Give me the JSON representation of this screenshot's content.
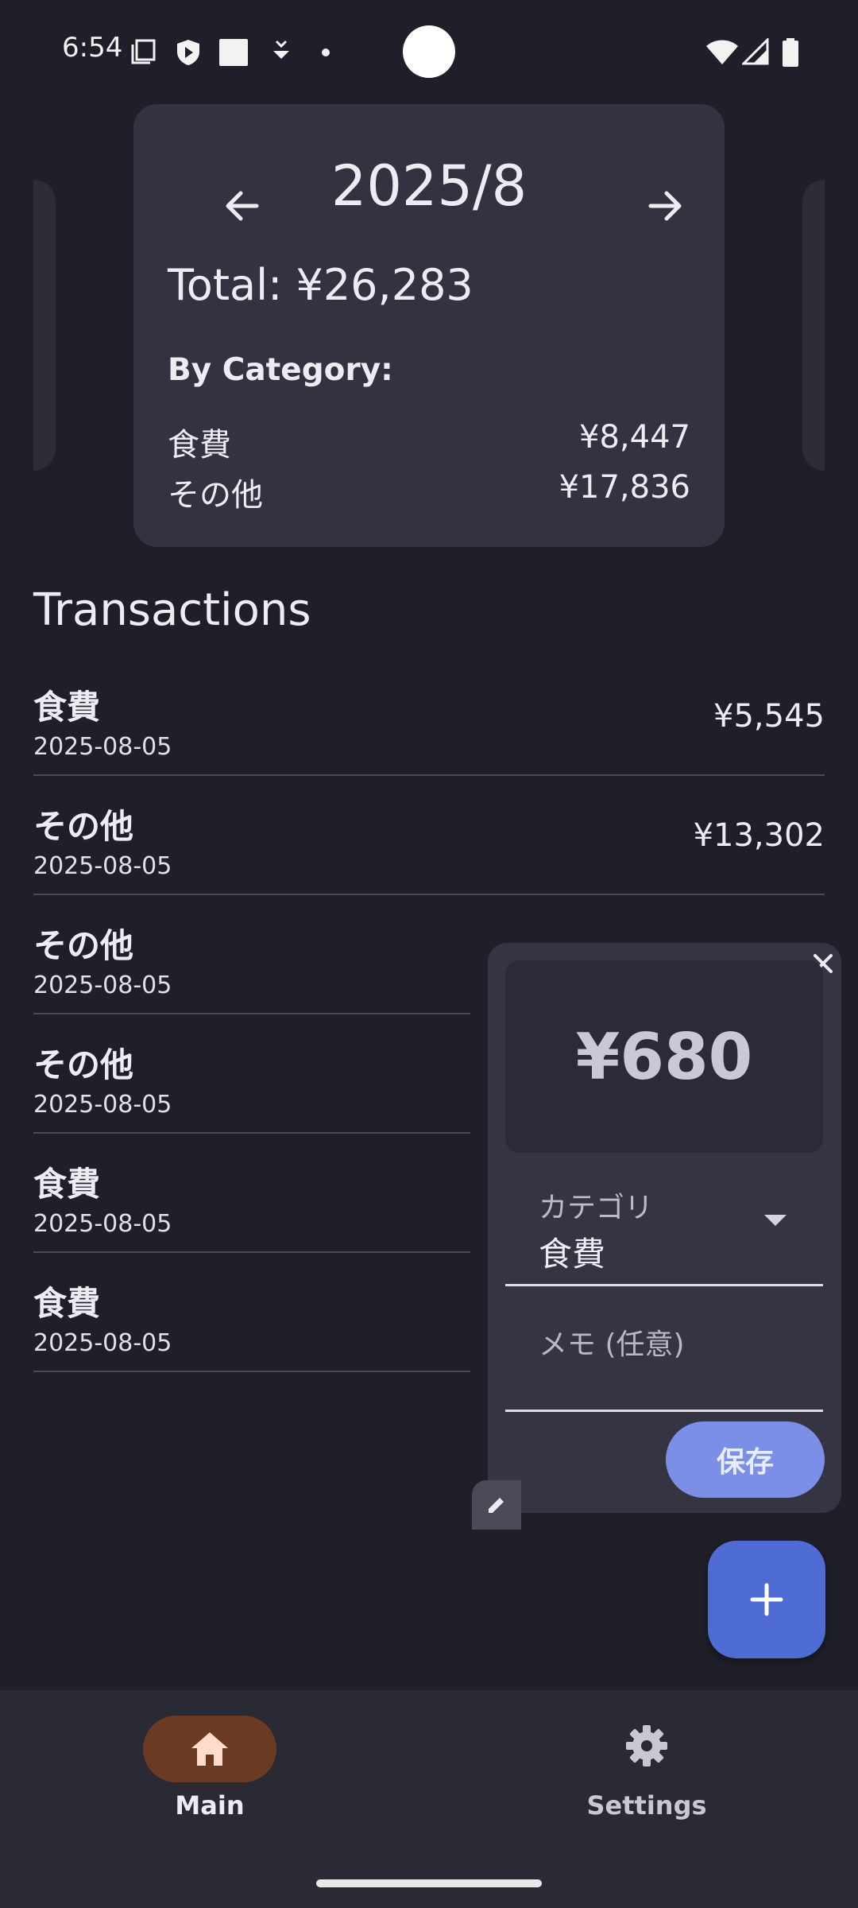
{
  "status_bar": {
    "time": "6:54",
    "icons": [
      "screenshot-icon",
      "shield-icon",
      "square-icon",
      "download-icon",
      "dot-icon",
      "wifi-icon",
      "signal-icon",
      "battery-icon"
    ]
  },
  "summary": {
    "month": "2025/8",
    "total": "Total: ¥26,283",
    "by_category_label": "By Category:",
    "categories": [
      {
        "name": "食費",
        "amount": "¥8,447"
      },
      {
        "name": "その他",
        "amount": "¥17,836"
      }
    ]
  },
  "transactions": {
    "heading": "Transactions",
    "items": [
      {
        "category": "食費",
        "date": "2025-08-05",
        "amount": "¥5,545"
      },
      {
        "category": "その他",
        "date": "2025-08-05",
        "amount": "¥13,302"
      },
      {
        "category": "その他",
        "date": "2025-08-05",
        "amount": ""
      },
      {
        "category": "その他",
        "date": "2025-08-05",
        "amount": ""
      },
      {
        "category": "食費",
        "date": "2025-08-05",
        "amount": ""
      },
      {
        "category": "食費",
        "date": "2025-08-05",
        "amount": ""
      }
    ]
  },
  "quick_entry": {
    "amount": "¥680",
    "category_label": "カテゴリ",
    "category_value": "食費",
    "memo_placeholder": "メモ (任意)",
    "memo_value": "",
    "save_label": "保存"
  },
  "bottom_nav": {
    "main_label": "Main",
    "settings_label": "Settings",
    "selected": "Main"
  },
  "colors": {
    "background": "#1f1f29",
    "card": "#323240",
    "accent_fab": "#4f6bd4",
    "save_button": "#7b8fe6",
    "nav_selected_pill": "#6a3a22"
  }
}
